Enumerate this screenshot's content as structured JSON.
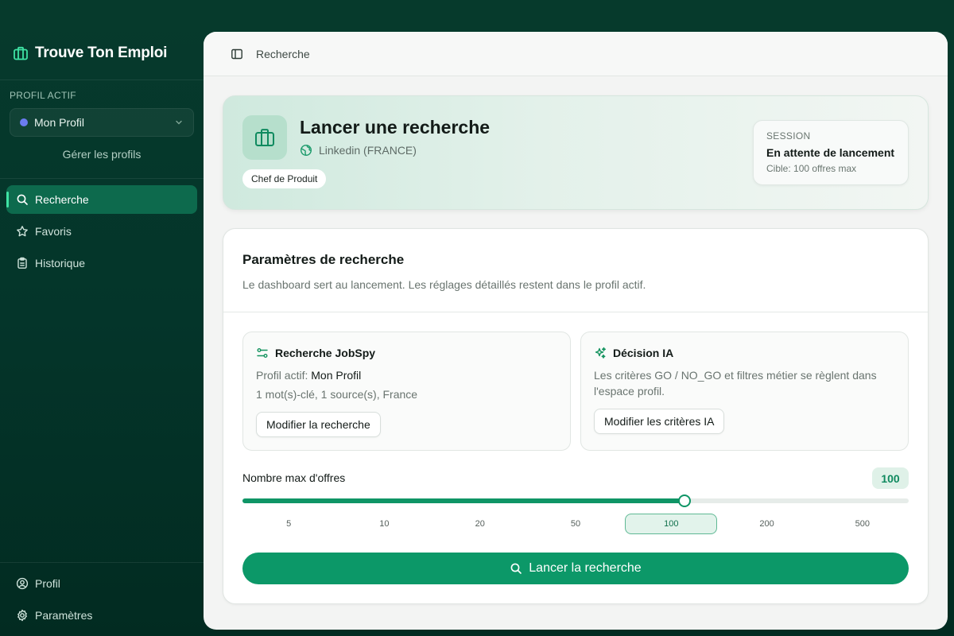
{
  "app": {
    "name": "Trouve Ton Emploi"
  },
  "sidebar": {
    "profile_caption": "PROFIL ACTIF",
    "active_profile": "Mon Profil",
    "manage_profiles": "Gérer les profils",
    "nav": [
      {
        "label": "Recherche",
        "icon": "search-icon",
        "active": true
      },
      {
        "label": "Favoris",
        "icon": "star-icon",
        "active": false
      },
      {
        "label": "Historique",
        "icon": "clipboard-icon",
        "active": false
      }
    ],
    "bottom_nav": [
      {
        "label": "Profil",
        "icon": "user-circle-icon"
      },
      {
        "label": "Paramètres",
        "icon": "gear-icon"
      }
    ]
  },
  "topbar": {
    "title": "Recherche"
  },
  "hero": {
    "title": "Lancer une recherche",
    "source": "Linkedin (FRANCE)",
    "keyword_chip": "Chef de Produit",
    "session": {
      "caption": "SESSION",
      "status": "En attente de lancement",
      "target": "Cible: 100 offres max"
    }
  },
  "params": {
    "title": "Paramètres de recherche",
    "description": "Le dashboard sert au lancement. Les réglages détaillés restent dans le profil actif.",
    "jobspy": {
      "title": "Recherche JobSpy",
      "profile_label": "Profil actif:",
      "profile_value": "Mon Profil",
      "summary": "1 mot(s)-clé, 1 source(s), France",
      "button": "Modifier la recherche"
    },
    "ia": {
      "title": "Décision IA",
      "description": "Les critères GO / NO_GO et filtres métier se règlent dans l'espace profil.",
      "button": "Modifier les critères IA"
    },
    "max_offers": {
      "label": "Nombre max d'offres",
      "value": "100",
      "options": [
        "5",
        "10",
        "20",
        "50",
        "100",
        "200",
        "500"
      ],
      "selected_index": 4,
      "fill_fraction": 0.664
    },
    "launch_button": "Lancer la recherche"
  },
  "colors": {
    "accent": "#0c9868",
    "sidebar_bg": "#063a2c",
    "brand_green": "#3fe3a4",
    "profile_dot": "#6b7cf0"
  }
}
